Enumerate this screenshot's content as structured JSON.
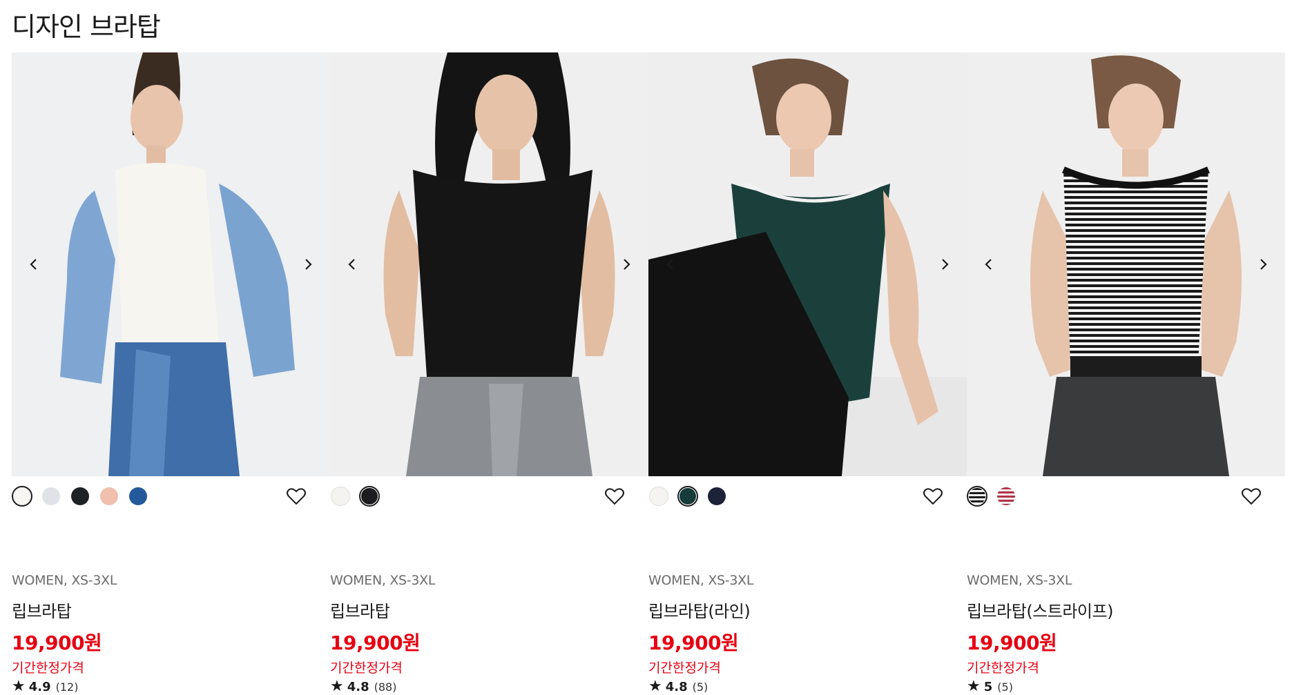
{
  "section_title": "디자인 브라탑",
  "products": [
    {
      "meta": "WOMEN, XS-3XL",
      "name": "립브라탑",
      "price": "19,900원",
      "promo": "기간한정가격",
      "rating": "4.9",
      "review_count": "(12)",
      "image_bg": "#eef0f1",
      "swatches": [
        {
          "color": "#f7f6f2",
          "selected": true
        },
        {
          "color": "#dfe2e6",
          "selected": false
        },
        {
          "color": "#1f2124",
          "selected": false
        },
        {
          "color": "#f0bfae",
          "selected": false
        },
        {
          "color": "#255a9a",
          "selected": false
        }
      ]
    },
    {
      "meta": "WOMEN, XS-3XL",
      "name": "립브라탑",
      "price": "19,900원",
      "promo": "기간한정가격",
      "rating": "4.8",
      "review_count": "(88)",
      "image_bg": "#efefef",
      "swatches": [
        {
          "color": "#f4f3ef",
          "selected": false
        },
        {
          "color": "#1d1d1f",
          "selected": true
        }
      ]
    },
    {
      "meta": "WOMEN, XS-3XL",
      "name": "립브라탑(라인)",
      "price": "19,900원",
      "promo": "기간한정가격",
      "rating": "4.8",
      "review_count": "(5)",
      "image_bg": "#eeeeef",
      "swatches": [
        {
          "color": "#f5f4f0",
          "selected": false
        },
        {
          "color": "#163c3a",
          "selected": true
        },
        {
          "color": "#1c2238",
          "selected": false
        }
      ]
    },
    {
      "meta": "WOMEN, XS-3XL",
      "name": "립브라탑(스트라이프)",
      "price": "19,900원",
      "promo": "기간한정가격",
      "rating": "5",
      "review_count": "(5)",
      "image_bg": "#efefef",
      "swatches": [
        {
          "color": "stripe-black",
          "selected": true
        },
        {
          "color": "stripe-red",
          "selected": false
        }
      ]
    }
  ],
  "icons": {
    "prev": "chevron-left-icon",
    "next": "chevron-right-icon",
    "wishlist": "heart-icon",
    "star": "star-icon"
  }
}
